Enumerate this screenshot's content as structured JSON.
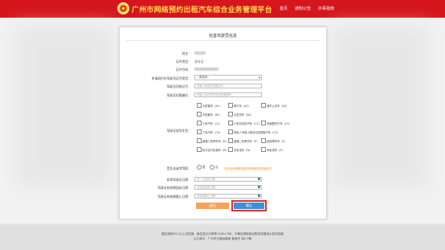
{
  "header": {
    "title": "广州市网络预约出租汽车综合业务管理平台",
    "nav": [
      "首页",
      "通知公告",
      "办事指南"
    ]
  },
  "form": {
    "title": "完善驾驶员信息",
    "fields": {
      "name_label": "姓名：",
      "id_type_label": "证件类型：",
      "id_type_value": "身份证",
      "id_number_label": "证件号码：",
      "license_type_label": "申请网约车驾驶员证件类型：",
      "license_type_value": "--请选择--",
      "card_number_label": "驾驶员资格证号：",
      "card_number_placeholder": "请输入驾驶员资格证号",
      "license_number_label": "驾驶证档案编号：",
      "license_number_placeholder": "请输入机动车驾驶证档案编号",
      "vehicle_class_label": "驾驶证准驾车型：",
      "exam_label": "是否本省考驾照：",
      "date_first_label": "初领驾驶证日期：",
      "date_first_placeholder": "请一次选择日期",
      "date_start_label": "驾驶证有效期起始日期：",
      "date_start_placeholder": "请选择起始日期",
      "date_end_label": "驾驶证有效期截止日期：",
      "date_end_placeholder": "请选择截止日期"
    },
    "vehicle_classes": [
      "大型客车（A1）",
      "牵引车（A2）",
      "城市公交车（A3）",
      "中型客车（B1）",
      "大型货车（B2）",
      "小型汽车（C1）",
      "小型自动挡汽车（C2）",
      "低速载货汽车（C3）",
      "三轮汽车（C4）",
      "残疾人专用小型自动挡载客汽车（C5）",
      "普通三轮摩托车（D）",
      "普通二轮摩托车（E）",
      "轻便摩托车（F）",
      "轮式自行机械车（M）",
      "无轨电车（N）",
      "有轨电车（P）"
    ],
    "exam_options": [
      "是",
      "否"
    ],
    "exam_note": "（非本省考驾照需提交有效期内的驾驶证件）",
    "buttons": {
      "back": "返回",
      "confirm": "确认"
    }
  },
  "footer": {
    "line1": "建议使用IE11以上浏览器，最佳显示分辨率1280x768，不兼容请使用谷歌浏览器或火狐浏览器",
    "line2": "主办单位：广州市交通运输局 备案号 粤ICP备"
  },
  "colors": {
    "header": "#d5161d",
    "title_text": "#ffd84d",
    "confirm": "#3d8fd8",
    "back": "#f3a45b",
    "highlight": "#e0312b"
  }
}
